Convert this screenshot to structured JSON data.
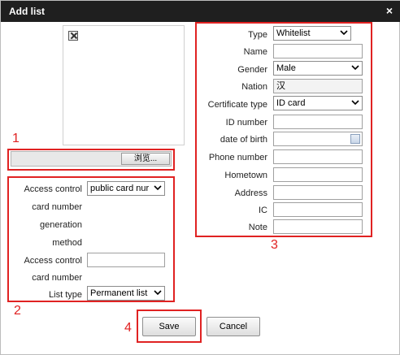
{
  "window": {
    "title": "Add list",
    "close_glyph": "×"
  },
  "photo": {
    "placeholder_icon": "broken-image-icon"
  },
  "file_picker": {
    "browse_label": "浏览..."
  },
  "annotations": {
    "n1": "1",
    "n2": "2",
    "n3": "3",
    "n4": "4",
    "color": "#e02222"
  },
  "access_panel": {
    "access_control_label": "Access control",
    "access_control_value": "public card nur",
    "gen_method_lines": [
      "card number",
      "generation",
      "method"
    ],
    "card_number_label_1": "Access control",
    "card_number_label_2": "card number",
    "card_number_value": "",
    "list_type_label": "List type",
    "list_type_value": "Permanent list"
  },
  "info_panel": {
    "type_label": "Type",
    "type_value": "Whitelist",
    "name_label": "Name",
    "name_value": "",
    "gender_label": "Gender",
    "gender_value": "Male",
    "nation_label": "Nation",
    "nation_value": "汉",
    "cert_type_label": "Certificate type",
    "cert_type_value": "ID card",
    "id_number_label": "ID number",
    "id_number_value": "",
    "dob_label": "date of birth",
    "dob_value": "",
    "phone_label": "Phone number",
    "phone_value": "",
    "hometown_label": "Hometown",
    "hometown_value": "",
    "address_label": "Address",
    "address_value": "",
    "ic_label": "IC",
    "ic_value": "",
    "note_label": "Note",
    "note_value": ""
  },
  "footer": {
    "save_label": "Save",
    "cancel_label": "Cancel"
  }
}
